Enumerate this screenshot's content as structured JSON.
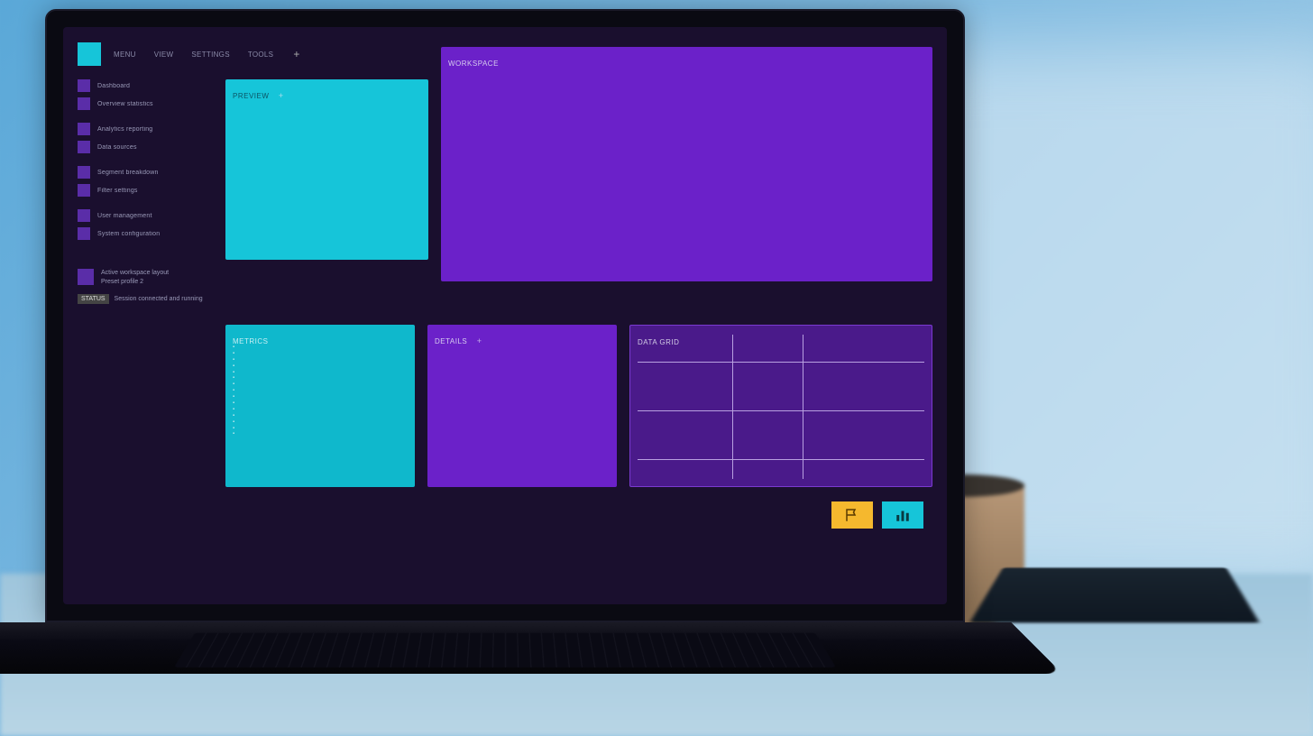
{
  "topbar": {
    "items": [
      "MENU",
      "VIEW",
      "SETTINGS",
      "TOOLS"
    ],
    "add": "+"
  },
  "sidebar": {
    "group1": [
      "Dashboard",
      "Overview statistics"
    ],
    "group2": [
      "Analytics reporting",
      "Data sources"
    ],
    "group3": [
      "Segment breakdown",
      "Filter settings"
    ],
    "group4": [
      "User management",
      "System configuration"
    ],
    "info1": {
      "line1": "Active workspace layout",
      "line2": "Preset profile 2"
    },
    "info2": {
      "badge": "STATUS",
      "text": "Session connected and running"
    }
  },
  "panels": {
    "small_cyan": {
      "label": "PREVIEW",
      "plus": "+"
    },
    "large": {
      "label": "WORKSPACE"
    },
    "cyan2": {
      "label": "METRICS"
    },
    "purple_mid": {
      "label": "DETAILS",
      "plus": "+"
    },
    "grid": {
      "label": "DATA GRID"
    }
  },
  "buttons": {
    "export": "export",
    "chart": "chart"
  },
  "colors": {
    "bg": "#1a0f2e",
    "purple": "#6b21c9",
    "purple_dark": "#4a1a8a",
    "cyan": "#16c5d9",
    "yellow": "#f5b82e"
  }
}
